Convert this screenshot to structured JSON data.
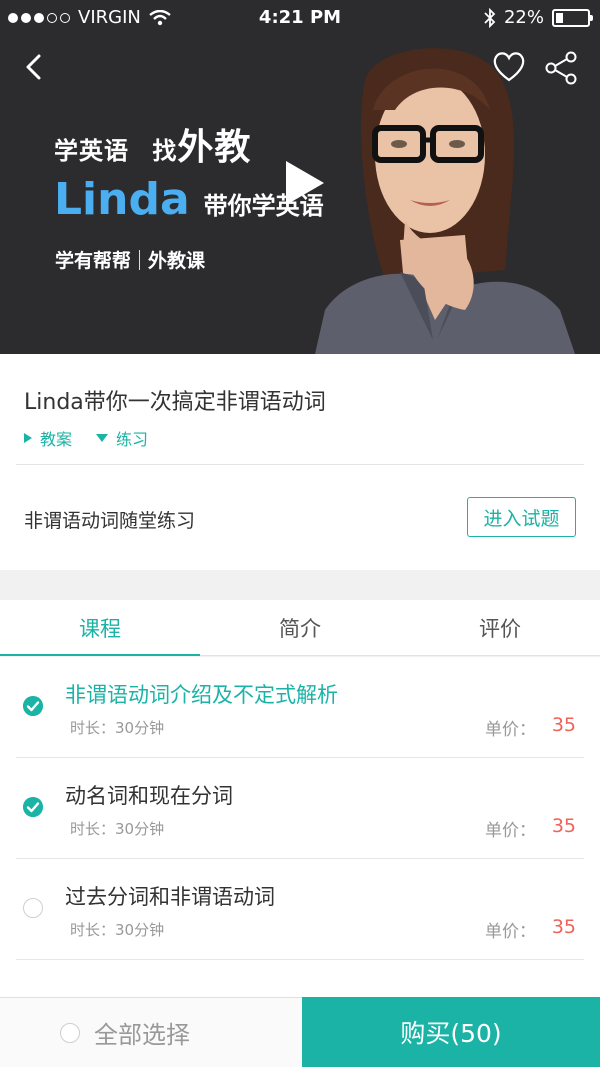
{
  "status_bar": {
    "carrier": "VIRGIN",
    "time": "4:21 PM",
    "battery": "22%",
    "battery_level": 0.22
  },
  "hero": {
    "line1_part1": "学英语",
    "line1_part2": "找",
    "line1_part3": "外教",
    "teacher": "Linda",
    "line2_rest": "带你学英语",
    "brand_left": "学有帮帮",
    "brand_right": "外教课"
  },
  "course": {
    "title": "Linda带你一次搞定非谓语动词",
    "chips": [
      "教案",
      "练习"
    ],
    "practice_label": "非谓语动词随堂练习",
    "practice_button": "进入试题"
  },
  "tabs": [
    {
      "label": "课程",
      "active": true
    },
    {
      "label": "简介",
      "active": false
    },
    {
      "label": "评价",
      "active": false
    }
  ],
  "lessons": [
    {
      "name": "非谓语动词介绍及不定式解析",
      "duration": "时长：30分钟",
      "price_label": "单价：",
      "price": "35",
      "checked": true,
      "highlight": true
    },
    {
      "name": "动名词和现在分词",
      "duration": "时长：30分钟",
      "price_label": "单价：",
      "price": "35",
      "checked": true,
      "highlight": false
    },
    {
      "name": "过去分词和非谓语动词",
      "duration": "时长：30分钟",
      "price_label": "单价：",
      "price": "35",
      "checked": false,
      "highlight": false
    }
  ],
  "bottom": {
    "select_all": "全部选择",
    "buy": "购买(50)"
  },
  "colors": {
    "accent": "#1ab3a6",
    "price": "#f0625a",
    "hero_bg": "#2c2c2e",
    "teacher_name": "#4aaef0"
  },
  "icons": [
    "back-icon",
    "heart-icon",
    "share-icon",
    "play-icon",
    "wifi-icon",
    "bluetooth-icon",
    "battery-icon",
    "check-icon"
  ]
}
